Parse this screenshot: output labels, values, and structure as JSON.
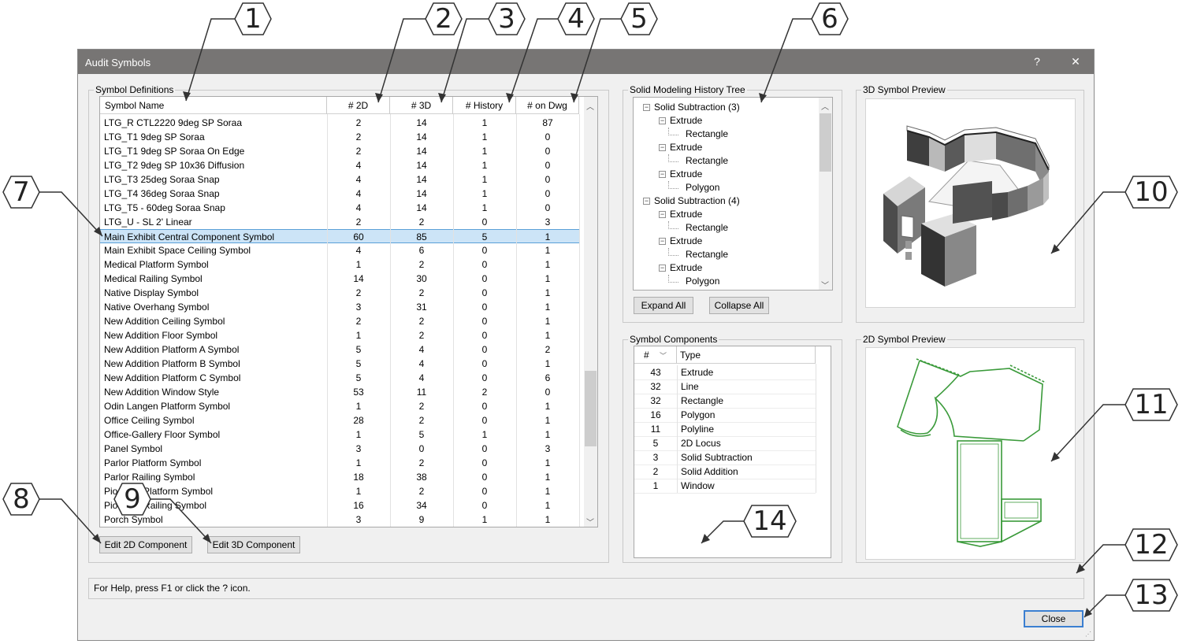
{
  "dialog": {
    "title": "Audit Symbols",
    "help_btn": "?",
    "close_x": "✕"
  },
  "symbol_definitions": {
    "label": "Symbol Definitions",
    "columns": [
      "Symbol Name",
      "# 2D",
      "# 3D",
      "# History",
      "# on Dwg"
    ],
    "rows": [
      [
        "LTG_R CTL2220 9deg SP Soraa",
        "2",
        "14",
        "1",
        "87"
      ],
      [
        "LTG_T1 9deg SP Soraa",
        "2",
        "14",
        "1",
        "0"
      ],
      [
        "LTG_T1 9deg SP Soraa On Edge",
        "2",
        "14",
        "1",
        "0"
      ],
      [
        "LTG_T2 9deg SP 10x36 Diffusion",
        "4",
        "14",
        "1",
        "0"
      ],
      [
        "LTG_T3 25deg Soraa Snap",
        "4",
        "14",
        "1",
        "0"
      ],
      [
        "LTG_T4 36deg Soraa Snap",
        "4",
        "14",
        "1",
        "0"
      ],
      [
        "LTG_T5 - 60deg Soraa Snap",
        "4",
        "14",
        "1",
        "0"
      ],
      [
        "LTG_U - SL 2' Linear",
        "2",
        "2",
        "0",
        "3"
      ],
      [
        "Main Exhibit Central Component Symbol",
        "60",
        "85",
        "5",
        "1"
      ],
      [
        "Main Exhibit Space Ceiling Symbol",
        "4",
        "6",
        "0",
        "1"
      ],
      [
        "Medical Platform Symbol",
        "1",
        "2",
        "0",
        "1"
      ],
      [
        "Medical Railing Symbol",
        "14",
        "30",
        "0",
        "1"
      ],
      [
        "Native Display Symbol",
        "2",
        "2",
        "0",
        "1"
      ],
      [
        "Native Overhang Symbol",
        "3",
        "31",
        "0",
        "1"
      ],
      [
        "New Addition Ceiling Symbol",
        "2",
        "2",
        "0",
        "1"
      ],
      [
        "New Addition Floor Symbol",
        "1",
        "2",
        "0",
        "1"
      ],
      [
        "New Addition Platform A Symbol",
        "5",
        "4",
        "0",
        "2"
      ],
      [
        "New Addition Platform B Symbol",
        "5",
        "4",
        "0",
        "1"
      ],
      [
        "New Addition Platform C Symbol",
        "5",
        "4",
        "0",
        "6"
      ],
      [
        "New Addition Window Style",
        "53",
        "11",
        "2",
        "0"
      ],
      [
        "Odin Langen Platform Symbol",
        "1",
        "2",
        "0",
        "1"
      ],
      [
        "Office Ceiling Symbol",
        "28",
        "2",
        "0",
        "1"
      ],
      [
        "Office-Gallery Floor Symbol",
        "1",
        "5",
        "1",
        "1"
      ],
      [
        "Panel Symbol",
        "3",
        "0",
        "0",
        "3"
      ],
      [
        "Parlor Platform Symbol",
        "1",
        "2",
        "0",
        "1"
      ],
      [
        "Parlor Railing Symbol",
        "18",
        "38",
        "0",
        "1"
      ],
      [
        "Pio     chen Platform Symbol",
        "1",
        "2",
        "0",
        "1"
      ],
      [
        "Pio      chen Railing Symbol",
        "16",
        "34",
        "0",
        "1"
      ],
      [
        "Porch Symbol",
        "3",
        "9",
        "1",
        "1"
      ]
    ],
    "selected_index": 8,
    "edit_2d": "Edit 2D Component",
    "edit_3d": "Edit 3D Component"
  },
  "history_tree": {
    "label": "Solid Modeling History Tree",
    "items": [
      {
        "text": "Solid Subtraction (3)",
        "level": 0,
        "toggle": "−"
      },
      {
        "text": "Extrude",
        "level": 1,
        "toggle": "−"
      },
      {
        "text": "Rectangle",
        "level": 2,
        "toggle": ""
      },
      {
        "text": "Extrude",
        "level": 1,
        "toggle": "−"
      },
      {
        "text": "Rectangle",
        "level": 2,
        "toggle": ""
      },
      {
        "text": "Extrude",
        "level": 1,
        "toggle": "−"
      },
      {
        "text": "Polygon",
        "level": 2,
        "toggle": ""
      },
      {
        "text": "Solid Subtraction (4)",
        "level": 0,
        "toggle": "−"
      },
      {
        "text": "Extrude",
        "level": 1,
        "toggle": "−"
      },
      {
        "text": "Rectangle",
        "level": 2,
        "toggle": ""
      },
      {
        "text": "Extrude",
        "level": 1,
        "toggle": "−"
      },
      {
        "text": "Rectangle",
        "level": 2,
        "toggle": ""
      },
      {
        "text": "Extrude",
        "level": 1,
        "toggle": "−"
      },
      {
        "text": "Polygon",
        "level": 2,
        "toggle": ""
      }
    ],
    "expand_all": "Expand All",
    "collapse_all": "Collapse All"
  },
  "components": {
    "label": "Symbol Components",
    "columns": [
      "#",
      "Type"
    ],
    "rows": [
      [
        "43",
        "Extrude"
      ],
      [
        "32",
        "Line"
      ],
      [
        "32",
        "Rectangle"
      ],
      [
        "16",
        "Polygon"
      ],
      [
        "11",
        "Polyline"
      ],
      [
        "5",
        "2D Locus"
      ],
      [
        "3",
        "Solid Subtraction"
      ],
      [
        "2",
        "Solid Addition"
      ],
      [
        "1",
        "Window"
      ]
    ]
  },
  "preview_3d": {
    "label": "3D Symbol Preview"
  },
  "preview_2d": {
    "label": "2D Symbol Preview"
  },
  "status_text": "For Help, press F1 or click the ? icon.",
  "close_button": "Close",
  "callouts": [
    "1",
    "2",
    "3",
    "4",
    "5",
    "6",
    "7",
    "8",
    "9",
    "10",
    "11",
    "12",
    "13",
    "14"
  ],
  "colors": {
    "selection": "#cce4f7",
    "titlebar": "#777574",
    "preview_2d_lines": "#3a9a3a"
  }
}
